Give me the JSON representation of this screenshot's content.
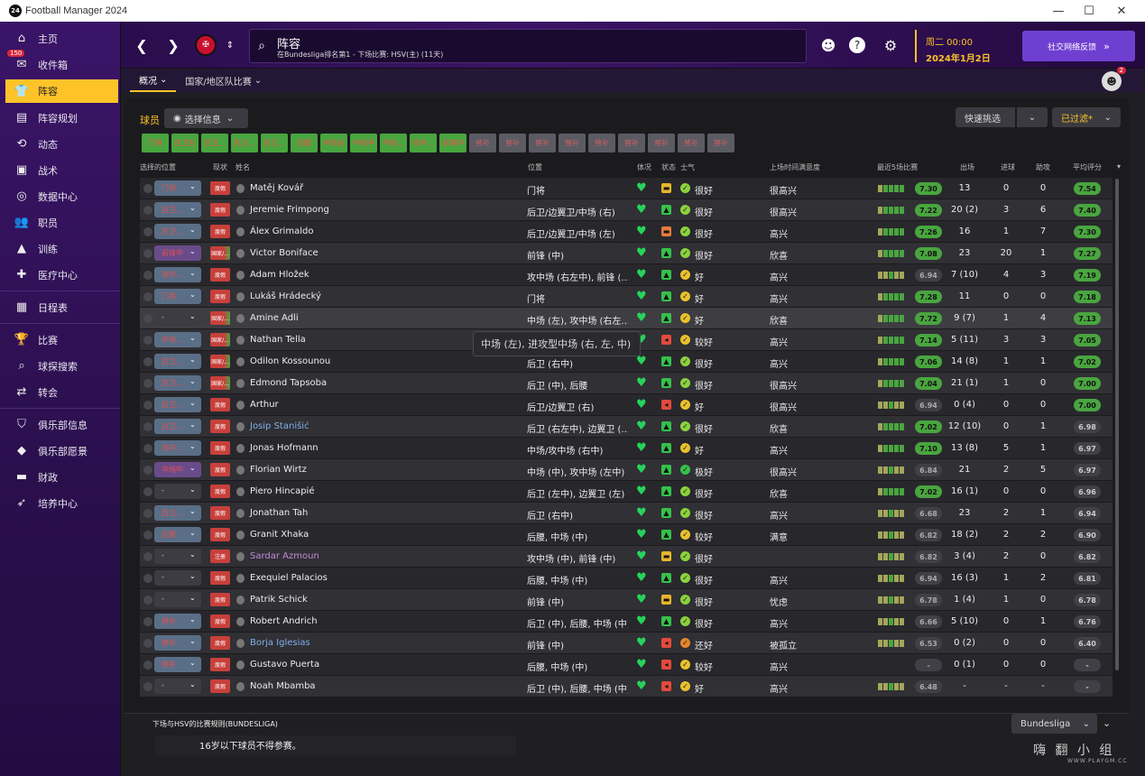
{
  "window": {
    "title": "Football Manager 2024",
    "logo_text": "24"
  },
  "sidebar": {
    "items": [
      {
        "label": "主页",
        "icon": "home-icon",
        "glyph": "⌂"
      },
      {
        "label": "收件箱",
        "icon": "inbox-icon",
        "glyph": "✉",
        "badge": "150"
      },
      {
        "label": "阵容",
        "icon": "squad-shirt-icon",
        "glyph": "👕",
        "active": true
      },
      {
        "label": "阵容规划",
        "icon": "clipboard-icon",
        "glyph": "▤"
      },
      {
        "label": "动态",
        "icon": "dynamics-icon",
        "glyph": "⟲"
      },
      {
        "label": "战术",
        "icon": "tactics-icon",
        "glyph": "▣"
      },
      {
        "label": "数据中心",
        "icon": "data-hub-icon",
        "glyph": "◎"
      },
      {
        "label": "职员",
        "icon": "staff-icon",
        "glyph": "👥"
      },
      {
        "label": "训练",
        "icon": "training-icon",
        "glyph": "▲"
      },
      {
        "label": "医疗中心",
        "icon": "medical-icon",
        "glyph": "✚"
      },
      {
        "label": "日程表",
        "icon": "calendar-icon",
        "glyph": "▦"
      },
      {
        "label": "比赛",
        "icon": "trophy-icon",
        "glyph": "🏆"
      },
      {
        "label": "球探搜索",
        "icon": "search-icon",
        "glyph": "⌕"
      },
      {
        "label": "转会",
        "icon": "transfer-icon",
        "glyph": "⇄"
      },
      {
        "label": "俱乐部信息",
        "icon": "club-shield-icon",
        "glyph": "⛉"
      },
      {
        "label": "俱乐部愿景",
        "icon": "vision-icon",
        "glyph": "◆"
      },
      {
        "label": "财政",
        "icon": "finance-icon",
        "glyph": "▬"
      },
      {
        "label": "培养中心",
        "icon": "development-icon",
        "glyph": "➶"
      }
    ]
  },
  "topbar": {
    "search_title": "阵容",
    "search_sub": "在Bundesliga排名第1 - 下场比赛: HSV(主) (11天)",
    "date_day": "周二 00:00",
    "date_full": "2024年1月2日",
    "social_label": "社交网络反馈"
  },
  "subnav": {
    "tab1": "概况",
    "tab2": "国家/地区队比赛"
  },
  "avatar_badge": "2",
  "toolbar": {
    "players_label": "球员",
    "select_info": "选择信息",
    "quick_pick": "快速挑选",
    "filtered": "已过滤*"
  },
  "position_tabs": [
    {
      "label": "门将",
      "on": true
    },
    {
      "label": "后卫右",
      "on": true
    },
    {
      "label": "后卫...",
      "on": true
    },
    {
      "label": "后卫...",
      "on": true
    },
    {
      "label": "后卫...",
      "on": true
    },
    {
      "label": "后腰",
      "on": true
    },
    {
      "label": "中场右",
      "on": true
    },
    {
      "label": "中场中",
      "on": true
    },
    {
      "label": "中场...",
      "on": true
    },
    {
      "label": "攻中...",
      "on": true
    },
    {
      "label": "前锋中",
      "on": true
    },
    {
      "label": "替补",
      "on": false
    },
    {
      "label": "替补",
      "on": false
    },
    {
      "label": "替补",
      "on": false
    },
    {
      "label": "替补",
      "on": false
    },
    {
      "label": "替补",
      "on": false
    },
    {
      "label": "替补",
      "on": false
    },
    {
      "label": "替补",
      "on": false
    },
    {
      "label": "替补",
      "on": false
    },
    {
      "label": "替补",
      "on": false
    }
  ],
  "columns": {
    "select": "选择的位置",
    "status": "现状",
    "name": "姓名",
    "position": "位置",
    "fitness": "体况",
    "condition": "状态",
    "morale": "士气",
    "playtime": "上场时间满意度",
    "form": "最近5场比赛",
    "apps": "出场",
    "goals": "进球",
    "assists": "助攻",
    "avg": "平均评分"
  },
  "players": [
    {
      "sel": "门将",
      "status": "度假",
      "name": "Matěj Kovář",
      "pos": "门将",
      "cond": "yellow",
      "mor": "很好",
      "happy": "很高兴",
      "form": "7.30",
      "apps": "13",
      "gls": "0",
      "ast": "0",
      "avg": "7.54"
    },
    {
      "sel": "后卫...",
      "status": "度假",
      "name": "Jeremie Frimpong",
      "pos": "后卫/边翼卫/中场 (右)",
      "cond": "green",
      "mor": "很好",
      "happy": "很高兴",
      "form": "7.22",
      "apps": "20 (2)",
      "gls": "3",
      "ast": "6",
      "avg": "7.40"
    },
    {
      "sel": "后卫...",
      "status": "度假",
      "name": "Álex Grimaldo",
      "pos": "后卫/边翼卫/中场 (左)",
      "cond": "orange",
      "mor": "很好",
      "happy": "高兴",
      "form": "7.26",
      "apps": "16",
      "gls": "1",
      "ast": "7",
      "avg": "7.30"
    },
    {
      "sel": "前锋中",
      "status": "国家/...",
      "name": "Victor Boniface",
      "pos": "前锋 (中)",
      "cond": "green",
      "mor": "很好",
      "happy": "欣喜",
      "form": "7.08",
      "apps": "23",
      "gls": "20",
      "ast": "1",
      "avg": "7.27"
    },
    {
      "sel": "攻中...",
      "status": "度假",
      "name": "Adam Hložek",
      "pos": "攻中场 (右左中), 前锋 (...",
      "cond": "green",
      "mor": "好",
      "happy": "高兴",
      "form": "6.94",
      "apps": "7 (10)",
      "gls": "4",
      "ast": "3",
      "avg": "7.19"
    },
    {
      "sel": "门将",
      "status": "度假",
      "name": "Lukáš Hrádecký",
      "pos": "门将",
      "cond": "green",
      "mor": "好",
      "happy": "高兴",
      "form": "7.28",
      "apps": "11",
      "gls": "0",
      "ast": "0",
      "avg": "7.18"
    },
    {
      "sel": "-",
      "status": "国家/...",
      "name": "Amine Adli",
      "pos": "中场 (左), 攻中场 (右左...",
      "cond": "green",
      "mor": "好",
      "happy": "欣喜",
      "form": "7.72",
      "apps": "9 (7)",
      "gls": "1",
      "ast": "4",
      "avg": "7.13"
    },
    {
      "sel": "中场...",
      "status": "国家/...",
      "name": "Nathan Tella",
      "pos": "攻中场 (右), 前锋 (中)",
      "cond": "red",
      "mor": "较好",
      "happy": "高兴",
      "form": "7.14",
      "apps": "5 (11)",
      "gls": "3",
      "ast": "3",
      "avg": "7.05"
    },
    {
      "sel": "后卫...",
      "status": "国家/...",
      "name": "Odilon Kossounou",
      "pos": "后卫 (右中)",
      "cond": "green",
      "mor": "很好",
      "happy": "高兴",
      "form": "7.06",
      "apps": "14 (8)",
      "gls": "1",
      "ast": "1",
      "avg": "7.02"
    },
    {
      "sel": "后卫...",
      "status": "国家/...",
      "name": "Edmond Tapsoba",
      "pos": "后卫 (中), 后腰",
      "cond": "green",
      "mor": "很好",
      "happy": "很高兴",
      "form": "7.04",
      "apps": "21 (1)",
      "gls": "1",
      "ast": "0",
      "avg": "7.00"
    },
    {
      "sel": "后卫...",
      "status": "度假",
      "name": "Arthur",
      "pos": "后卫/边翼卫 (右)",
      "cond": "red",
      "mor": "好",
      "happy": "很高兴",
      "form": "6.94",
      "apps": "0 (4)",
      "gls": "0",
      "ast": "0",
      "avg": "7.00"
    },
    {
      "sel": "后卫...",
      "status": "度假",
      "name": "Josip Stanišić",
      "pos": "后卫 (右左中), 边翼卫 (...",
      "cond": "green",
      "mor": "很好",
      "happy": "欣喜",
      "form": "7.02",
      "apps": "12 (10)",
      "gls": "0",
      "ast": "1",
      "avg": "6.98"
    },
    {
      "sel": "攻中...",
      "status": "度假",
      "name": "Jonas Hofmann",
      "pos": "中场/攻中场 (右中)",
      "cond": "green",
      "mor": "好",
      "happy": "高兴",
      "form": "7.10",
      "apps": "13 (8)",
      "gls": "5",
      "ast": "1",
      "avg": "6.97"
    },
    {
      "sel": "中场中",
      "status": "度假",
      "name": "Florian Wirtz",
      "pos": "中场 (中), 攻中场 (左中)",
      "cond": "green",
      "mor": "极好",
      "happy": "很高兴",
      "form": "6.84",
      "apps": "21",
      "gls": "2",
      "ast": "5",
      "avg": "6.97"
    },
    {
      "sel": "-",
      "status": "度假",
      "name": "Piero Hincapié",
      "pos": "后卫 (左中), 边翼卫 (左)",
      "cond": "green",
      "mor": "很好",
      "happy": "欣喜",
      "form": "7.02",
      "apps": "16 (1)",
      "gls": "0",
      "ast": "0",
      "avg": "6.96"
    },
    {
      "sel": "后卫...",
      "status": "度假",
      "name": "Jonathan Tah",
      "pos": "后卫 (右中)",
      "cond": "green",
      "mor": "很好",
      "happy": "高兴",
      "form": "6.68",
      "apps": "23",
      "gls": "2",
      "ast": "1",
      "avg": "6.94"
    },
    {
      "sel": "后腰",
      "status": "度假",
      "name": "Granit Xhaka",
      "pos": "后腰, 中场 (中)",
      "cond": "green",
      "mor": "较好",
      "happy": "满意",
      "form": "6.82",
      "apps": "18 (2)",
      "gls": "2",
      "ast": "2",
      "avg": "6.90"
    },
    {
      "sel": "-",
      "status": "注册",
      "name": "Sardar Azmoun",
      "pos": "攻中场 (中), 前锋 (中)",
      "cond": "yellow",
      "mor": "很好",
      "happy": "",
      "form": "6.82",
      "apps": "3 (4)",
      "gls": "2",
      "ast": "0",
      "avg": "6.82"
    },
    {
      "sel": "-",
      "status": "度假",
      "name": "Exequiel Palacios",
      "pos": "后腰, 中场 (中)",
      "cond": "green",
      "mor": "很好",
      "happy": "高兴",
      "form": "6.94",
      "apps": "16 (3)",
      "gls": "1",
      "ast": "2",
      "avg": "6.81"
    },
    {
      "sel": "-",
      "status": "度假",
      "name": "Patrik Schick",
      "pos": "前锋 (中)",
      "cond": "yellow",
      "mor": "很好",
      "happy": "忧虑",
      "form": "6.78",
      "apps": "1 (4)",
      "gls": "1",
      "ast": "0",
      "avg": "6.78"
    },
    {
      "sel": "替补",
      "status": "度假",
      "name": "Robert Andrich",
      "pos": "后卫 (中), 后腰, 中场 (中)",
      "cond": "green",
      "mor": "很好",
      "happy": "高兴",
      "form": "6.66",
      "apps": "5 (10)",
      "gls": "0",
      "ast": "1",
      "avg": "6.76"
    },
    {
      "sel": "替补",
      "status": "度假",
      "name": "Borja Iglesias",
      "pos": "前锋 (中)",
      "cond": "red",
      "mor": "还好",
      "happy": "被孤立",
      "form": "6.53",
      "apps": "0 (2)",
      "gls": "0",
      "ast": "0",
      "avg": "6.40"
    },
    {
      "sel": "替补",
      "status": "度假",
      "name": "Gustavo Puerta",
      "pos": "后腰, 中场 (中)",
      "cond": "red",
      "mor": "较好",
      "happy": "高兴",
      "form": "-",
      "apps": "0 (1)",
      "gls": "0",
      "ast": "0",
      "avg": "-"
    },
    {
      "sel": "-",
      "status": "度假",
      "name": "Noah Mbamba",
      "pos": "后卫 (中), 后腰, 中场 (中)",
      "cond": "red",
      "mor": "好",
      "happy": "高兴",
      "form": "6.48",
      "apps": "-",
      "gls": "-",
      "ast": "-",
      "avg": "-"
    }
  ],
  "tooltip": "中场 (左), 进攻型中场 (右, 左, 中)",
  "footer": {
    "rule_title": "下场与HSV的比赛规则(BUNDESLIGA)",
    "rule_text": "16岁以下球员不得参赛。",
    "league": "Bundesliga"
  },
  "watermark": {
    "text": "嗨 翻 小 组",
    "url": "WWW.PLAYGM.CC"
  }
}
